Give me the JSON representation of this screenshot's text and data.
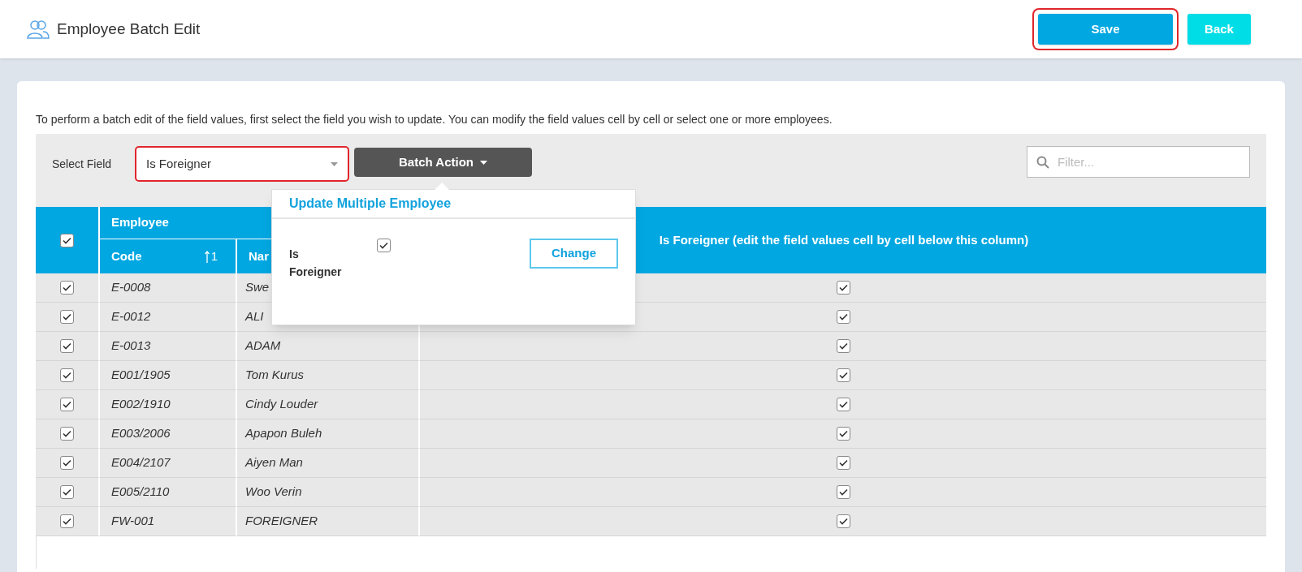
{
  "header": {
    "title": "Employee Batch Edit",
    "buttons": [
      {
        "label": "Save",
        "kind": "primary",
        "highlighted": true
      },
      {
        "label": "Back",
        "kind": "secondary",
        "highlighted": false
      }
    ]
  },
  "intro": "To perform a batch edit of the field values, first select the field you wish to update. You can modify the field values cell by cell or select one or more employees.",
  "toolbar": {
    "select_label": "Select Field",
    "select_value": "Is Foreigner",
    "select_highlighted": true,
    "batch_button": "Batch Action",
    "filter_placeholder": "Filter..."
  },
  "popup": {
    "title": "Update Multiple Employee",
    "field_label": "Is Foreigner",
    "checked": true,
    "button": "Change"
  },
  "table": {
    "select_all_checked": true,
    "group_header": "Employee",
    "columns": [
      {
        "label": "Code",
        "sort_rank": "1"
      },
      {
        "label": "Nar"
      }
    ],
    "value_header": "Is Foreigner (edit the field values cell by cell below this column)",
    "rows": [
      {
        "selected": true,
        "code": "E-0008",
        "name": "Swe",
        "value": true
      },
      {
        "selected": true,
        "code": "E-0012",
        "name": "ALI",
        "value": true
      },
      {
        "selected": true,
        "code": "E-0013",
        "name": "ADAM",
        "value": true
      },
      {
        "selected": true,
        "code": "E001/1905",
        "name": "Tom Kurus",
        "value": true
      },
      {
        "selected": true,
        "code": "E002/1910",
        "name": "Cindy Louder",
        "value": true
      },
      {
        "selected": true,
        "code": "E003/2006",
        "name": "Apapon Buleh",
        "value": true
      },
      {
        "selected": true,
        "code": "E004/2107",
        "name": "Aiyen Man",
        "value": true
      },
      {
        "selected": true,
        "code": "E005/2110",
        "name": "Woo Verin",
        "value": true
      },
      {
        "selected": true,
        "code": "FW-001",
        "name": "FOREIGNER",
        "value": true
      }
    ]
  }
}
